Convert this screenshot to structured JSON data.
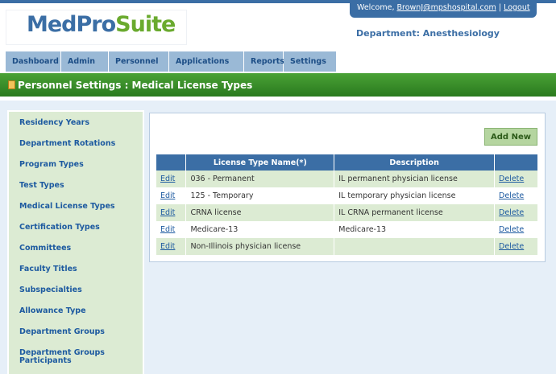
{
  "header": {
    "logo_part1": "MedPro",
    "logo_part2": "Suite",
    "welcome_prefix": "Welcome, ",
    "user_email": "BrownJ@mpshospital.com",
    "separator": " | ",
    "logout_label": "Logout",
    "department": "Department: Anesthesiology"
  },
  "nav": {
    "tabs": [
      {
        "label": "Dashboard"
      },
      {
        "label": "Admin"
      },
      {
        "label": "Personnel"
      },
      {
        "label": "Applications"
      },
      {
        "label": "Reports"
      },
      {
        "label": "Settings"
      }
    ]
  },
  "page": {
    "title": "Personnel Settings : Medical License Types"
  },
  "sidebar": {
    "items": [
      {
        "label": "Residency Years"
      },
      {
        "label": "Department Rotations"
      },
      {
        "label": "Program Types"
      },
      {
        "label": "Test Types"
      },
      {
        "label": "Medical License Types"
      },
      {
        "label": "Certification Types"
      },
      {
        "label": "Committees"
      },
      {
        "label": "Faculty Titles"
      },
      {
        "label": "Subspecialties"
      },
      {
        "label": "Allowance Type"
      },
      {
        "label": "Department Groups"
      },
      {
        "label": "Department Groups Participants"
      }
    ]
  },
  "panel": {
    "add_new_label": "Add New",
    "columns": [
      "",
      "License Type Name(*)",
      "Description",
      ""
    ],
    "rows": [
      {
        "edit": "Edit",
        "name": "036 - Permanent",
        "description": "IL permanent physician license",
        "delete": "Delete"
      },
      {
        "edit": "Edit",
        "name": "125 - Temporary",
        "description": "IL temporary physician license",
        "delete": "Delete"
      },
      {
        "edit": "Edit",
        "name": "CRNA license",
        "description": "IL CRNA permanent license",
        "delete": "Delete"
      },
      {
        "edit": "Edit",
        "name": "Medicare-13",
        "description": "Medicare-13",
        "delete": "Delete"
      },
      {
        "edit": "Edit",
        "name": "Non-Illinois physician license",
        "description": "",
        "delete": "Delete"
      }
    ]
  },
  "colors": {
    "brand_blue": "#3b6ea5",
    "brand_green": "#6aaa2e",
    "row_alt": "#dcebd3"
  }
}
